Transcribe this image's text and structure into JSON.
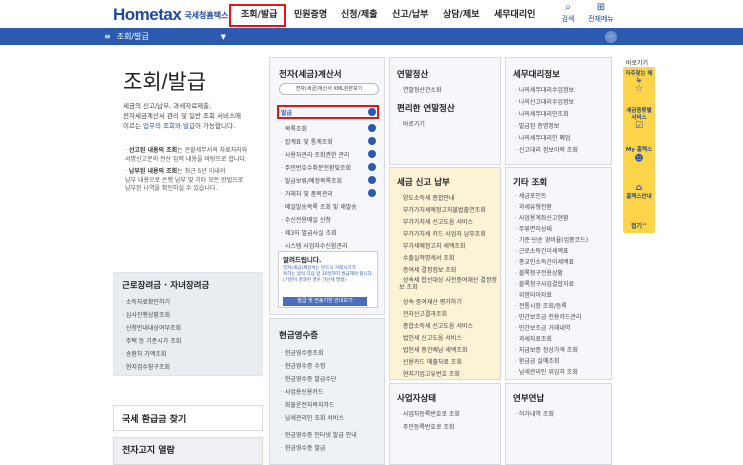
{
  "header": {
    "logo_text": "Hometax",
    "logo_sub": "국세청홈택스",
    "nav": [
      "조회/발급",
      "민원증명",
      "신청/제출",
      "신고/납부",
      "상담/제보",
      "세무대리인"
    ],
    "search_label": "검색",
    "allmenu_label": "전체메뉴"
  },
  "subbar": {
    "current": "조회/발급"
  },
  "left": {
    "title": "조회/발급",
    "desc_1": "세금의 신고/납부, 과세자료제출,",
    "desc_2": "전자세금계산서 관리 및 일반 조회 서비스에",
    "desc_3a": "이르는 ",
    "desc_3_link": "업무의 조회와 발급",
    "desc_3b": "이 가능합니다.",
    "note1_bold": "선고된 내용의 조회",
    "note1_rest": "는 관할세무서의 자료처리와",
    "note1_l2": "서명신고분의 전산 입력 내용을 바탕으로 합니다.",
    "note2_bold": "납부된 내용의 조회",
    "note2_rest": "는 최근 5년 이내의",
    "note2_l2": "납부 내용으로 은행 납부 및 기타 모든 방법으로",
    "note2_l3": "납부된 나역을 확인하실 수 있습니다.",
    "list_title": "근로장려금 · 자녀장려금",
    "list_items": [
      "소득자료확인하기",
      "심사진행상황조회",
      "신청안내대상여부조회",
      "주택 등 기준시가 조회",
      "송환차 가액조회",
      "현지검수참구조회"
    ],
    "refund_label": "국세 환급금 찾기",
    "notice_label": "전자고지 열람"
  },
  "etax": {
    "title": "전자(세금)계산서",
    "pill": "전자(세금)계산서 XML원본보기",
    "issue": "발급",
    "items": [
      "목록조회",
      "합계표 및 통계조회",
      "사용자관리",
      "주민번호수취분전환및조회",
      "발급보류/예정목록조회",
      "거래처 및 품목관리",
      "메일발송목록 조회 및 재발송",
      "수신전용메일 신청",
      "제3자 발급사실 조회",
      "시스템 사업자수신함관리"
    ],
    "item_extra_2": "조회권한 관리",
    "alert_title": "알려드립니다.",
    "alert_text_1": "전자(세금)계산서는 반드시 거래시기가",
    "alert_text_2": "속하는 달의 다음 달 10일까지 발급해야 합니다.",
    "alert_text_3": "(기한이 경과된 경우 가산세 발생)",
    "alert_btn": "발급 및 전송기한 안내보기"
  },
  "cash": {
    "title": "현금영수증",
    "items": [
      "현금영수증조회",
      "현금영수증 수정",
      "현금영수증 발급수단",
      "사업용신용카드",
      "화물운전자복지카드",
      "납세관리인 조회 서비스",
      "현금영수증 인터넷 발급 안내",
      "현금영수증 발급"
    ]
  },
  "yearend": {
    "title": "연말정산",
    "items": [
      "연말정산간소화"
    ],
    "subtitle": "편리한 연말정산",
    "sub_items": [
      "바로가기"
    ]
  },
  "report": {
    "title": "세금 신고 납부",
    "items": [
      "양도소득세 종합안내",
      "부가가치세예정고지불법출연조회",
      "부가가치세 신고도움 서비스",
      "부가가치세 카드 사업자 납부조회",
      "부가세예정고지 세액조회",
      "수출실적명세서 조회",
      "증여세 결정정보 조회",
      "상속세 합산대상 사전증여재산 결정정보 조회",
      "상속·증여재산 평가하기",
      "전자신고결과조회",
      "종합소득세 신고도움 서비스",
      "법인세 신고도움 서비스",
      "법인세 중간예납 세액조회",
      "신용카드 매출자료 조회",
      "현지기업고유번호 조회",
      "납부내역 조회"
    ]
  },
  "biz": {
    "title": "사업자상태",
    "items": [
      "사업자등록번호로 조회",
      "주민등록번호로 조회"
    ]
  },
  "agent": {
    "title": "세무대리정보",
    "items": [
      "나의세무대리수임정보",
      "나의신고대리수임정보",
      "나의세무대리인조회",
      "발급된 증명정보",
      "나의세무대리인 폐업",
      "신고대리 정보이력 조회"
    ]
  },
  "etc": {
    "title": "기타 조회",
    "items": [
      "세금포인트",
      "과세유형전환",
      "사업용계좌신고현황",
      "주류면허상태",
      "기준·단순 경비율(업종코드)",
      "근로소득간이세액표",
      "종교인소득간이세액표",
      "블록청구전용상황",
      "블록청구사업결합자료",
      "위험되어자료",
      "전통시장 조회/등록",
      "민간보조금 전용카드관리",
      "민간보조금 거래내역",
      "과세자료조회",
      "지급보증 정상가격 조회",
      "환급금 실예조회",
      "납세관리인 위임자 조회"
    ]
  },
  "pension": {
    "title": "연부연납",
    "items": [
      "허가내역 조회"
    ]
  },
  "quick": {
    "label": "바로가기",
    "items": [
      {
        "label": "자주찾는 메뉴",
        "icon": "star-icon"
      },
      {
        "label": "세금종류별 서비스",
        "icon": "check-icon"
      },
      {
        "label": "My 홈택스",
        "icon": "person-icon"
      },
      {
        "label": "홈택스안내",
        "icon": "home-icon"
      }
    ],
    "close": "접기"
  },
  "colors": {
    "accent": "#2b5aaf",
    "highlight": "#e8141b",
    "quick": "#fbd44a"
  }
}
